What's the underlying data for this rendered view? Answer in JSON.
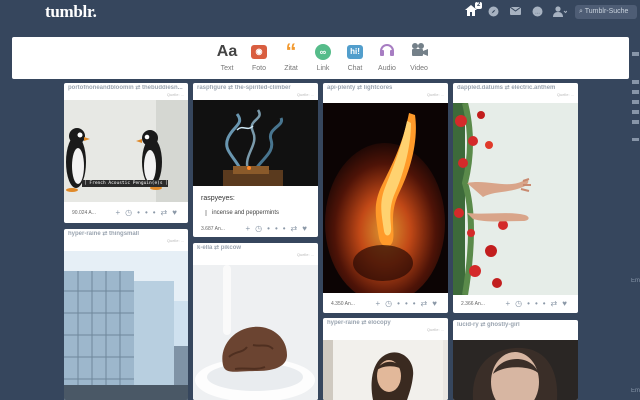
{
  "header": {
    "logo": "tumblr.",
    "notification_count": "2",
    "search_placeholder": "Tumblr-Suche",
    "icons": [
      "home-icon",
      "compass-icon",
      "mail-icon",
      "ask-icon",
      "account-icon"
    ]
  },
  "composer": {
    "types": [
      {
        "label": "Text",
        "icon": "Aa"
      },
      {
        "label": "Foto",
        "icon": "camera-icon"
      },
      {
        "label": "Zitat",
        "icon": "quote-icon"
      },
      {
        "label": "Link",
        "icon": "link-icon"
      },
      {
        "label": "Chat",
        "icon": "hi!"
      },
      {
        "label": "Audio",
        "icon": "headphones-icon"
      },
      {
        "label": "Video",
        "icon": "video-icon"
      }
    ]
  },
  "posts": [
    {
      "user": "portofnoneandbloomin ⇄ thebuddiesn...",
      "source": "Quelle: ...",
      "notes": "90.024 A...",
      "image_caption": "[ French Acoustic Penguin(e)s ]"
    },
    {
      "user": "raspfigure ⇄ the-spirited-climber",
      "source": "Quelle: ...",
      "notes": "3.687 An...",
      "title": "raspyeyes:",
      "quote": "incense and peppermints"
    },
    {
      "user": "api-plenty ⇄ lightcores",
      "source": "Quelle: ...",
      "notes": "4.350 An..."
    },
    {
      "user": "dappled.datums ⇄ electric.anthem",
      "source": "Quelle: ...",
      "notes": "2.366 An..."
    },
    {
      "user": "hyper-raine ⇄ thingsmall",
      "source": "Quelle: ..."
    },
    {
      "user": "k-ella ⇄ pikcow",
      "source": "Quelle: ..."
    },
    {
      "user": "hyper-raine ⇄ elocopy",
      "source": "Quelle: ..."
    },
    {
      "user": "lucid-ry ⇄ ghostly-girl",
      "source": ""
    }
  ],
  "actions": [
    "+",
    "◷",
    "•••",
    "⇄",
    "♥"
  ],
  "rail": [
    "Em",
    "Em"
  ],
  "colors": {
    "background": "#36465d",
    "text_icon": "#444444",
    "photo_icon": "#d95e40",
    "quote_icon": "#f2992e",
    "link_icon": "#56bc8a",
    "chat_icon": "#529ecc",
    "audio_icon": "#a77dc2",
    "video_icon": "#748089"
  }
}
